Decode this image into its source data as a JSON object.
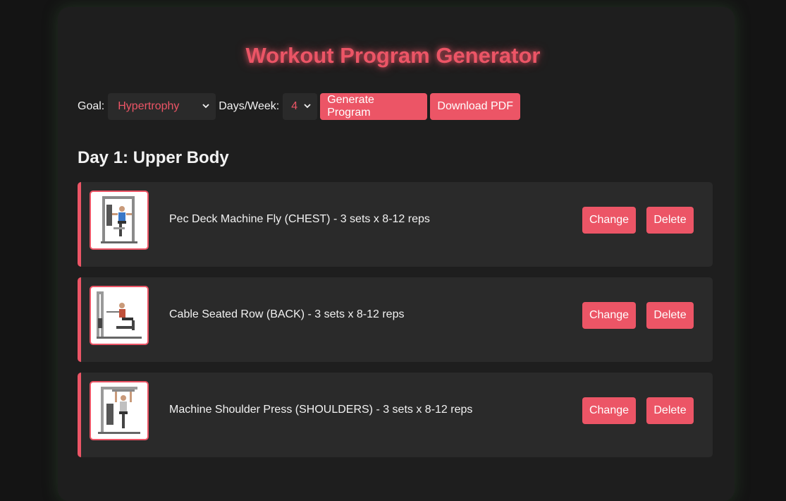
{
  "page": {
    "title": "Workout Program Generator"
  },
  "controls": {
    "goal_label": "Goal:",
    "goal_value": "Hypertrophy",
    "days_label": "Days/Week:",
    "days_value": "4",
    "generate_label": "Generate Program",
    "download_label": "Download PDF"
  },
  "day": {
    "title": "Day 1: Upper Body"
  },
  "exercises": [
    {
      "text": "Pec Deck Machine Fly (CHEST) - 3 sets x 8-12 reps",
      "image_icon": "pec-deck-machine-icon",
      "change_label": "Change",
      "delete_label": "Delete"
    },
    {
      "text": "Cable Seated Row (BACK) - 3 sets x 8-12 reps",
      "image_icon": "cable-row-machine-icon",
      "change_label": "Change",
      "delete_label": "Delete"
    },
    {
      "text": "Machine Shoulder Press (SHOULDERS) - 3 sets x 8-12 reps",
      "image_icon": "shoulder-press-machine-icon",
      "change_label": "Change",
      "delete_label": "Delete"
    }
  ],
  "colors": {
    "accent": "#ec5566",
    "background": "#141414",
    "panel": "#1e1e1e",
    "card": "#2a2a2a",
    "text": "#f2f2f2"
  }
}
